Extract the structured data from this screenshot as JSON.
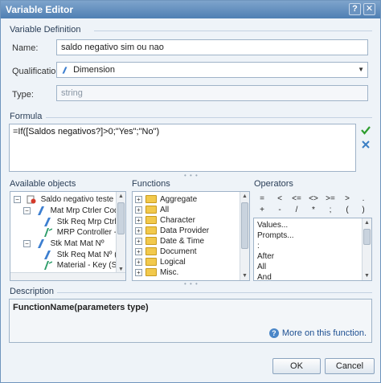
{
  "window": {
    "title": "Variable Editor"
  },
  "definition": {
    "section_title": "Variable Definition",
    "name_label": "Name:",
    "name_value": "saldo negativo sim ou nao",
    "qualification_label": "Qualification:",
    "qualification_value": "Dimension",
    "type_label": "Type:",
    "type_value": "string"
  },
  "formula": {
    "section_title": "Formula",
    "text": "=If([Saldos negativos?]>0;\"Yes\";\"No\")"
  },
  "objects": {
    "section_title": "Available objects",
    "items": [
      {
        "label": "Saldo negativo teste"
      },
      {
        "label": "Mat Mrp Ctrler Cod"
      },
      {
        "label": "Stk Req Mrp Ctrler C"
      },
      {
        "label": "MRP Controller - Ke"
      },
      {
        "label": "Stk Mat Mat Nº"
      },
      {
        "label": "Stk Req Mat Nº (Mo"
      },
      {
        "label": "Material - Key (Stoc"
      }
    ]
  },
  "functions": {
    "section_title": "Functions",
    "items": [
      "Aggregate",
      "All",
      "Character",
      "Data Provider",
      "Date & Time",
      "Document",
      "Logical",
      "Misc."
    ]
  },
  "operators": {
    "section_title": "Operators",
    "row1": [
      "=",
      "<",
      "<=",
      "<>",
      ">=",
      ">",
      "."
    ],
    "row2": [
      "+",
      "-",
      "/",
      "*",
      ";",
      "(",
      ")"
    ],
    "list": [
      "Values...",
      "Prompts...",
      ":",
      "After",
      "All",
      "And"
    ]
  },
  "description": {
    "section_title": "Description",
    "text": "FunctionName(parameters type)",
    "more_link": "More on this function."
  },
  "buttons": {
    "ok": "OK",
    "cancel": "Cancel"
  },
  "colors": {
    "titlebar": "#4f7fb3",
    "accept": "#2e9d2e",
    "reject": "#3b7fc4"
  }
}
